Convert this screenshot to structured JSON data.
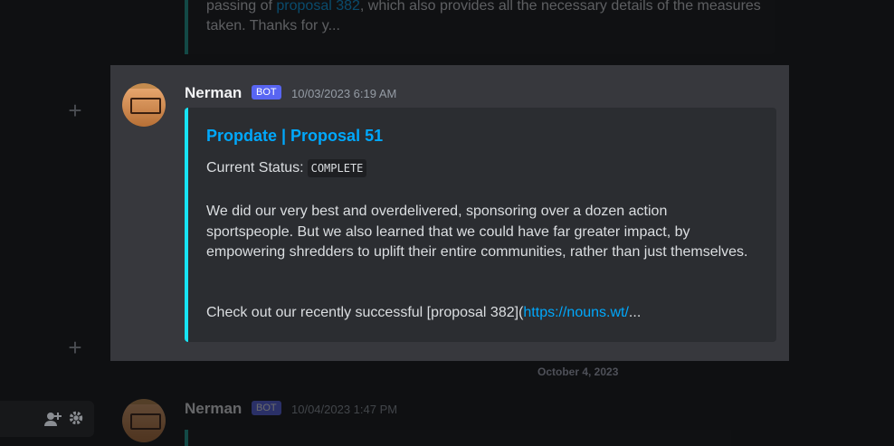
{
  "previous_message": {
    "text_before": "passing of ",
    "link_text": "proposal 382",
    "text_after": ", which also provides all the necessary details of the measures taken. Thanks for y..."
  },
  "messages": [
    {
      "author": "Nerman",
      "badge": "BOT",
      "timestamp": "10/03/2023 6:19 AM",
      "embed": {
        "title": "Propdate | Proposal 51",
        "status_label": "Current Status:",
        "status_value": "COMPLETE",
        "body": "We did our very best and overdelivered, sponsoring over a dozen action sportspeople. But we also learned that we could have far greater impact, by empowering shredders to uplift their entire communities, rather than just themselves.",
        "cta_text": "Check out our recently successful [proposal 382](",
        "cta_link": "https://nouns.wt/",
        "cta_ellipsis": "..."
      }
    },
    {
      "author": "Nerman",
      "badge": "BOT",
      "timestamp": "10/04/2023 1:47 PM"
    }
  ],
  "date_divider": "October 4, 2023",
  "icons": {
    "add_1": "plus-icon",
    "add_2": "plus-icon",
    "add_friend": "add-friend-icon",
    "settings": "gear-icon"
  }
}
